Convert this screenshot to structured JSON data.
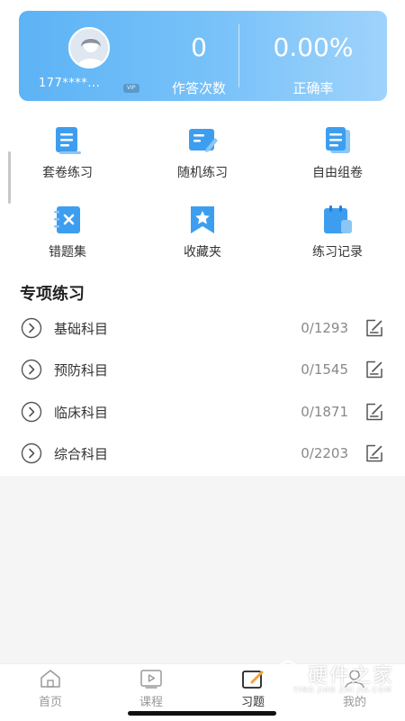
{
  "stats": {
    "user_phone": "177****...",
    "badge": "VIP",
    "answer_count": "0",
    "answer_count_label": "作答次数",
    "accuracy": "0.00%",
    "accuracy_label": "正确率"
  },
  "functions": [
    {
      "label": "套卷练习",
      "icon": "paper-set-icon"
    },
    {
      "label": "随机练习",
      "icon": "random-practice-icon"
    },
    {
      "label": "自由组卷",
      "icon": "custom-paper-icon"
    },
    {
      "label": "错题集",
      "icon": "wrong-questions-icon"
    },
    {
      "label": "收藏夹",
      "icon": "favorites-icon"
    },
    {
      "label": "练习记录",
      "icon": "practice-record-icon"
    }
  ],
  "special_practice": {
    "title": "专项练习",
    "subjects": [
      {
        "name": "基础科目",
        "progress": "0/1293"
      },
      {
        "name": "预防科目",
        "progress": "0/1545"
      },
      {
        "name": "临床科目",
        "progress": "0/1871"
      },
      {
        "name": "综合科目",
        "progress": "0/2203"
      }
    ]
  },
  "tabbar": {
    "items": [
      {
        "label": "首页",
        "icon": "home-icon"
      },
      {
        "label": "课程",
        "icon": "video-course-icon"
      },
      {
        "label": "习题",
        "icon": "exercise-icon",
        "active": true
      },
      {
        "label": "我的",
        "icon": "profile-icon"
      }
    ]
  },
  "watermark": {
    "title": "硬件之家",
    "subtitle": "YING JIAN ZHI JIA.COM"
  },
  "colors": {
    "accent": "#4aa8f0",
    "card_gradient_start": "#5db3f5",
    "card_gradient_end": "#9fd3fb",
    "icon_blue": "#3d9ef0"
  }
}
